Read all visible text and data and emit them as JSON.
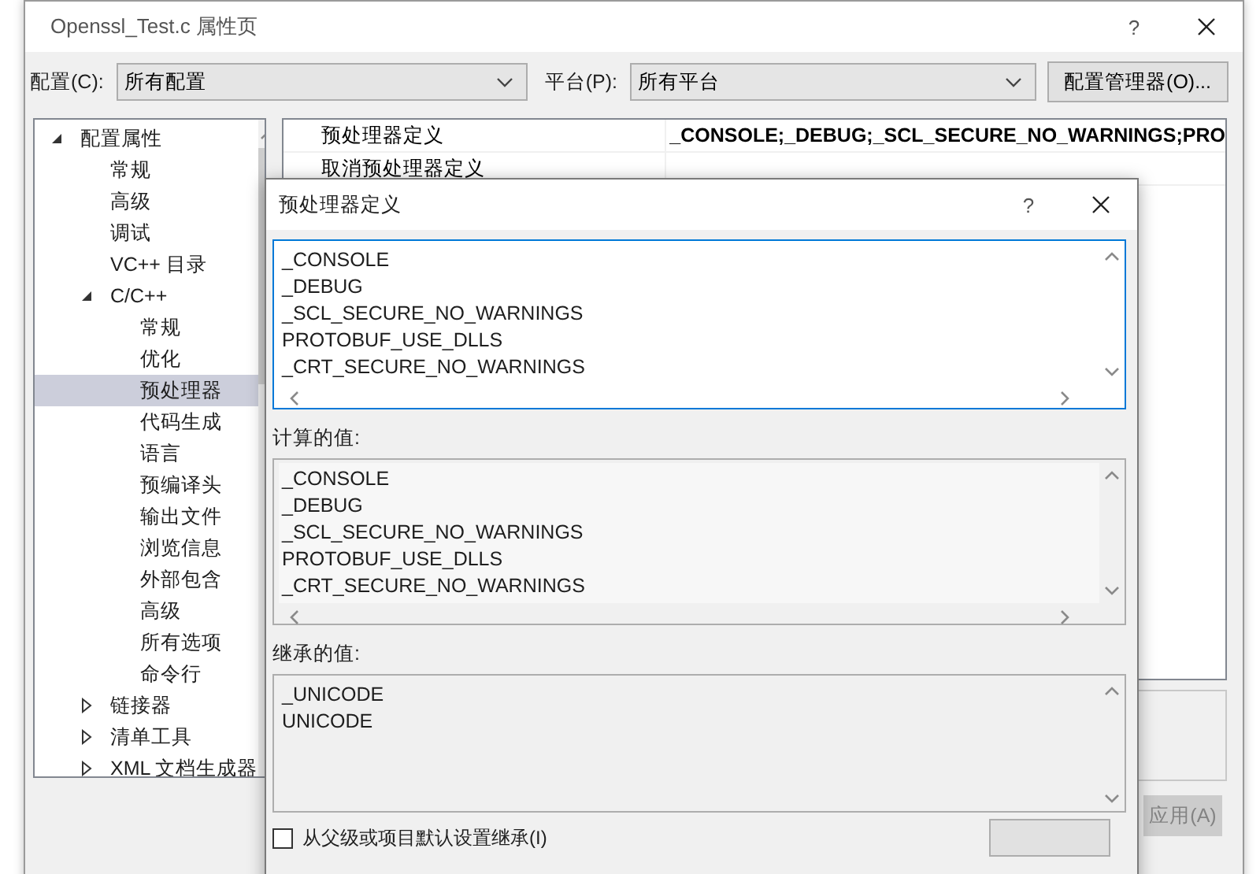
{
  "window": {
    "title": "Openssl_Test.c 属性页",
    "help": "?"
  },
  "toolbar": {
    "config_label": "配置(C):",
    "config_value": "所有配置",
    "platform_label": "平台(P):",
    "platform_value": "所有平台",
    "manager_button": "配置管理器(O)..."
  },
  "tree": [
    {
      "label": "配置属性",
      "expanded": true,
      "selected": false,
      "children": [
        {
          "label": "常规",
          "selected": false
        },
        {
          "label": "高级",
          "selected": false
        },
        {
          "label": "调试",
          "selected": false
        },
        {
          "label": "VC++ 目录",
          "selected": false
        },
        {
          "label": "C/C++",
          "expanded": true,
          "selected": false,
          "children": [
            {
              "label": "常规",
              "selected": false
            },
            {
              "label": "优化",
              "selected": false
            },
            {
              "label": "预处理器",
              "selected": true
            },
            {
              "label": "代码生成",
              "selected": false
            },
            {
              "label": "语言",
              "selected": false
            },
            {
              "label": "预编译头",
              "selected": false
            },
            {
              "label": "输出文件",
              "selected": false
            },
            {
              "label": "浏览信息",
              "selected": false
            },
            {
              "label": "外部包含",
              "selected": false
            },
            {
              "label": "高级",
              "selected": false
            },
            {
              "label": "所有选项",
              "selected": false
            },
            {
              "label": "命令行",
              "selected": false
            }
          ]
        },
        {
          "label": "链接器",
          "expanded": false,
          "selected": false
        },
        {
          "label": "清单工具",
          "expanded": false,
          "selected": false
        },
        {
          "label": "XML 文档生成器",
          "expanded": false,
          "selected": false
        }
      ]
    }
  ],
  "grid": {
    "rows": [
      {
        "name": "预处理器定义",
        "value": "_CONSOLE;_DEBUG;_SCL_SECURE_NO_WARNINGS;PRO"
      },
      {
        "name": "取消预处理器定义"
      }
    ]
  },
  "apply_button": {
    "label": "应用(A)",
    "disabled": true
  },
  "dialog": {
    "title": "预处理器定义",
    "help": "?",
    "definitions": [
      "_CONSOLE",
      "_DEBUG",
      "_SCL_SECURE_NO_WARNINGS",
      "PROTOBUF_USE_DLLS",
      "_CRT_SECURE_NO_WARNINGS"
    ],
    "computed_label": "计算的值:",
    "computed": [
      "_CONSOLE",
      "_DEBUG",
      "_SCL_SECURE_NO_WARNINGS",
      "PROTOBUF_USE_DLLS",
      "_CRT_SECURE_NO_WARNINGS"
    ],
    "inherited_label": "继承的值:",
    "inherited": [
      "_UNICODE",
      "UNICODE"
    ],
    "inherit_checkbox": {
      "label": "从父级或项目默认设置继承(I)",
      "checked": false
    }
  }
}
